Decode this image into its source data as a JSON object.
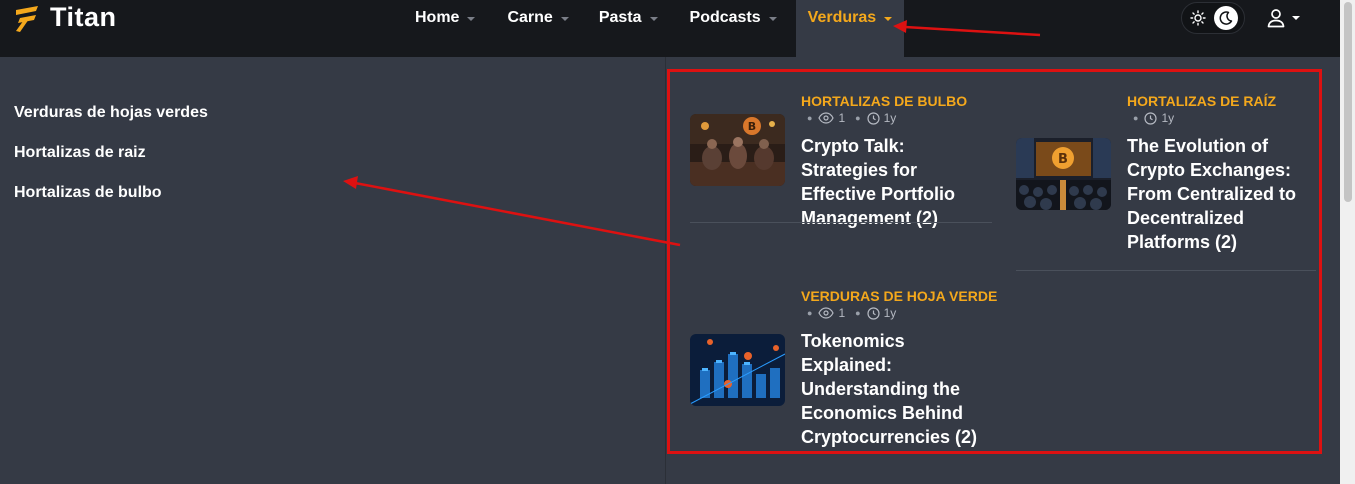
{
  "logo": {
    "text": "Titan"
  },
  "nav": {
    "items": [
      {
        "label": "Home"
      },
      {
        "label": "Carne"
      },
      {
        "label": "Pasta"
      },
      {
        "label": "Podcasts"
      },
      {
        "label": "Verduras"
      }
    ]
  },
  "side_menu": {
    "items": [
      {
        "label": "Verduras de hojas verdes"
      },
      {
        "label": "Hortalizas de raiz"
      },
      {
        "label": "Hortalizas de bulbo"
      }
    ]
  },
  "posts": [
    {
      "category": "HORTALIZAS DE BULBO",
      "views": "1",
      "age": "1y",
      "title": "Crypto Talk: Strategies for Effective Portfolio Management (2)"
    },
    {
      "category": "HORTALIZAS DE RAÍZ",
      "age": "1y",
      "title": "The Evolution of Crypto Exchanges: From Centralized to Decentralized Platforms (2)"
    },
    {
      "category": "VERDURAS DE HOJA VERDE",
      "views": "1",
      "age": "1y",
      "title": "Tokenomics Explained: Understanding the Economics Behind Cryptocurrencies (2)"
    }
  ],
  "colors": {
    "accent": "#f4a81c",
    "header_bg": "#16181c",
    "page_bg": "#353a45",
    "annotation": "#dd1111"
  },
  "icons": [
    "logo-icon",
    "sun-icon",
    "moon-icon",
    "user-icon",
    "eye-icon",
    "clock-icon",
    "caret-down-icon"
  ]
}
